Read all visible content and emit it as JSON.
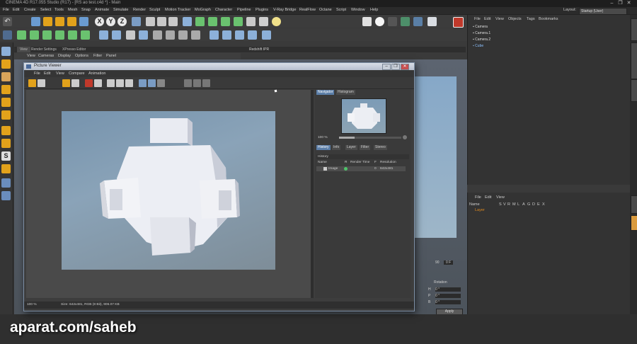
{
  "app": {
    "title": "CINEMA 4D R17.055 Studio (R17) - [RS ao test.c4d *] - Main",
    "window_buttons": [
      "–",
      "❐",
      "✕"
    ],
    "layout_label": "Layout:",
    "layout_value": "Startup (User)"
  },
  "menubar": [
    "File",
    "Edit",
    "Create",
    "Select",
    "Tools",
    "Mesh",
    "Snap",
    "Animate",
    "Simulate",
    "Render",
    "Sculpt",
    "Motion Tracker",
    "MoGraph",
    "Character",
    "Pipeline",
    "Plugins",
    "V-Ray Bridge",
    "RealFlow",
    "Octane",
    "Script",
    "Window",
    "Help"
  ],
  "toolbar": {
    "axis_x": "X",
    "axis_y": "Y",
    "axis_z": "Z"
  },
  "viewport": {
    "tabs": [
      "View",
      "Render Settings",
      "XPresso Editor"
    ],
    "menu": [
      "View",
      "Cameras",
      "Display",
      "Options",
      "Filter",
      "Panel"
    ],
    "redshift_tab": "Redshift IPR"
  },
  "object_manager": {
    "menu": [
      "File",
      "Edit",
      "View",
      "Objects",
      "Tags",
      "Bookmarks"
    ],
    "objects": [
      "Camera",
      "Camera.1",
      "Camera.2",
      "Cube"
    ]
  },
  "layer_manager": {
    "menu": [
      "File",
      "Edit",
      "View"
    ],
    "columns": [
      "Name",
      "S",
      "V",
      "R",
      "M",
      "L",
      "A",
      "G",
      "D",
      "E",
      "X"
    ],
    "layer_name": "Layer"
  },
  "attributes": {
    "rotation_label": "Rotation",
    "fields": [
      "H",
      "P",
      "B"
    ],
    "values": [
      "0 °",
      "0 °",
      "0 °"
    ],
    "apply_label": "Apply",
    "frame_value": "0 F",
    "frame_end": "90"
  },
  "picture_viewer": {
    "title": "Picture Viewer",
    "menu": [
      "File",
      "Edit",
      "View",
      "Compare",
      "Animation"
    ],
    "status_zoom": "100 %",
    "status_info": "Size: 642x481, RGB (8 Bit), 906.07 KB",
    "side_tabs_top": [
      "Navigator",
      "Histogram"
    ],
    "nav_zoom": "100 %",
    "side_tabs": [
      "History",
      "Info",
      "Layer",
      "Filter",
      "Stereo"
    ],
    "history_label": "History",
    "history_columns": [
      "Name",
      "R",
      "Render Time",
      "F",
      "Resolution"
    ],
    "history_row": {
      "name": "Image",
      "frame": "0",
      "resolution": "642x481"
    }
  },
  "watermark": "aparat.com/saheb",
  "colors": {
    "accent_blue": "#5b7ea8",
    "bg_dark": "#3a3a3a",
    "layer_orange": "#e08a1e"
  }
}
